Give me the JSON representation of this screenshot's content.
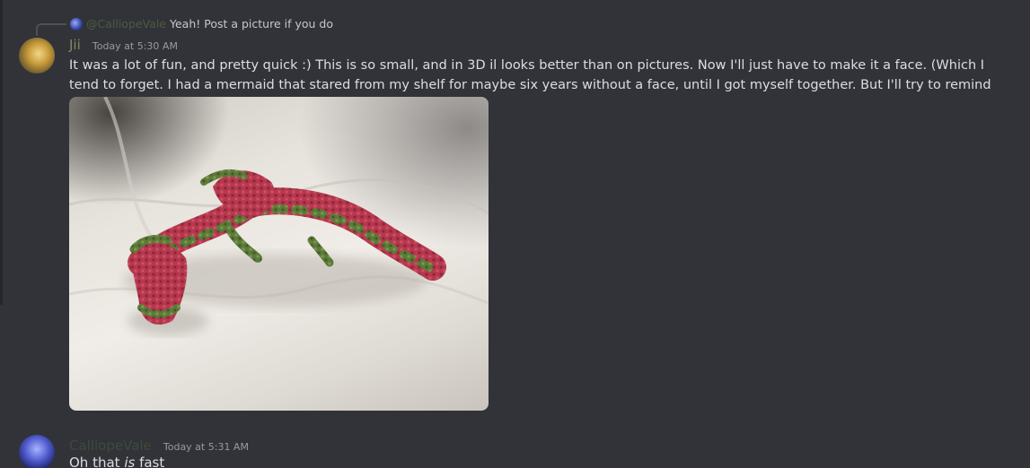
{
  "reply": {
    "author": "@CalliopeVale",
    "text": "Yeah! Post a picture if you do"
  },
  "messages": [
    {
      "author": "Jii",
      "timestamp": "Today at 5:30 AM",
      "text": "It was a lot of fun, and pretty quick :) This is so small, and in 3D il looks better than on pictures. Now I'll just have to make it a face. (Which I tend to forget. I had a mermaid that stared from my shelf for maybe six years without a face, until I got myself together. But I'll try to remind myself)"
    },
    {
      "author": "CalliopeVale",
      "timestamp": "Today at 5:31 AM",
      "text_before": "Oh that ",
      "text_em": "is",
      "text_after": " fast"
    }
  ],
  "colors": {
    "background": "#313338",
    "author_jii": "#7e8a5e",
    "author_calliope": "#3e4a3a",
    "timestamp": "#949ba4",
    "body_text": "#dbdee1"
  },
  "icons": {
    "reply_spine": "reply-line-icon"
  }
}
